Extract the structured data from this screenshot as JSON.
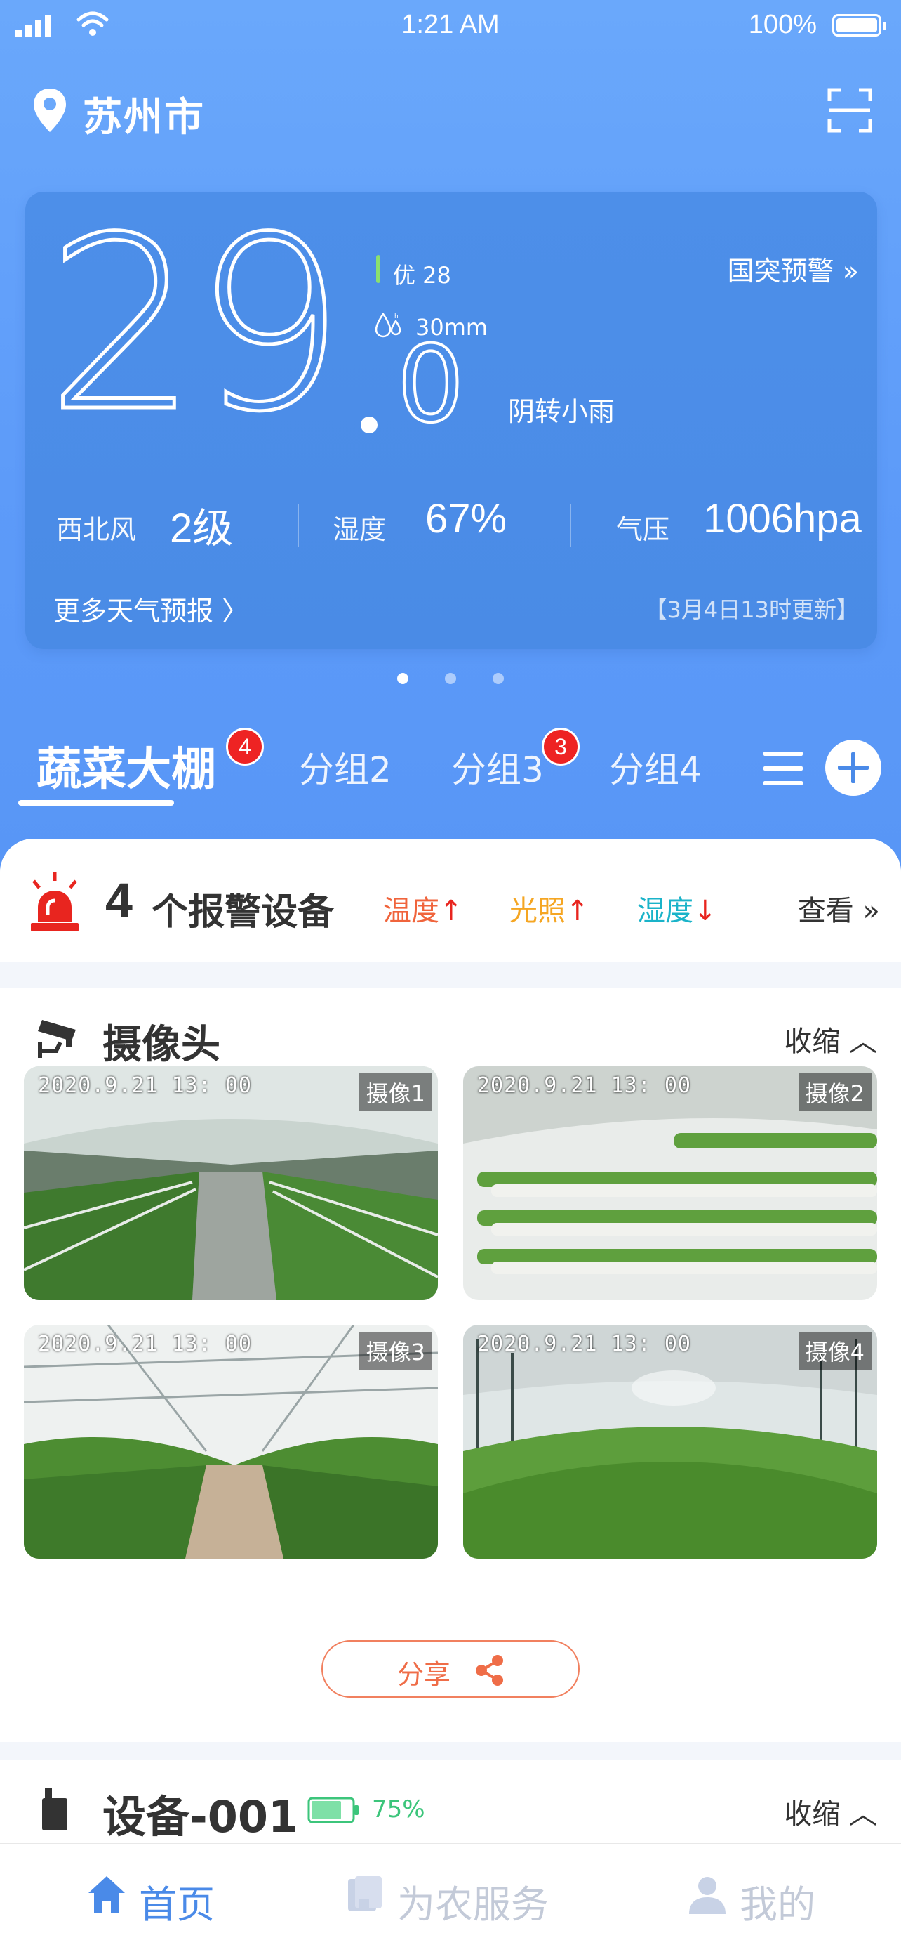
{
  "status_bar": {
    "time": "1:21 AM",
    "battery": "100%"
  },
  "header": {
    "city": "苏州市",
    "location_icon": "location-pin-icon",
    "scan_icon": "scan-icon"
  },
  "weather": {
    "temp_int": "29",
    "temp_dot": ".",
    "temp_dec": "0",
    "aqi": "优 28",
    "rainfall": "30mm",
    "condition": "阴转小雨",
    "alert_link": "国突预警 »",
    "wind_label": "西北风",
    "wind_value": "2级",
    "humidity_label": "湿度",
    "humidity_value": "67%",
    "pressure_label": "气压",
    "pressure_value": "1006hpa",
    "more_link": "更多天气预报 〉",
    "updated": "【3月4日13时更新】"
  },
  "pager": {
    "pages": 3,
    "active": 0
  },
  "tabs": [
    {
      "label": "蔬菜大棚",
      "badge": "4",
      "active": true
    },
    {
      "label": "分组2",
      "badge": "",
      "active": false
    },
    {
      "label": "分组3",
      "badge": "3",
      "active": false
    },
    {
      "label": "分组4",
      "badge": "",
      "active": false
    }
  ],
  "alarm": {
    "count": "4",
    "title": "个报警设备",
    "tags": [
      {
        "label": "温度",
        "arrow": "↑",
        "color": "#f0643c"
      },
      {
        "label": "光照",
        "arrow": "↑",
        "color": "#f5a623"
      },
      {
        "label": "湿度",
        "arrow": "↓",
        "color": "#1ab3c9"
      }
    ],
    "view": "查看 »"
  },
  "camera_section": {
    "title": "摄像头",
    "collapse": "收缩 ︿",
    "cameras": [
      {
        "time": "2020.9.21 13: 00",
        "label": "摄像1"
      },
      {
        "time": "2020.9.21 13: 00",
        "label": "摄像2"
      },
      {
        "time": "2020.9.21 13: 00",
        "label": "摄像3"
      },
      {
        "time": "2020.9.21 13: 00",
        "label": "摄像4"
      }
    ],
    "share": "分享"
  },
  "device_section": {
    "title": "设备-001",
    "battery": "75%",
    "collapse": "收缩 ︿"
  },
  "tab_bar": [
    {
      "label": "首页",
      "icon": "home-icon",
      "active": true
    },
    {
      "label": "为农服务",
      "icon": "book-icon",
      "active": false
    },
    {
      "label": "我的",
      "icon": "user-icon",
      "active": false
    }
  ],
  "colors": {
    "primary": "#4a8ae8",
    "alarm_red": "#e8251f",
    "share_orange": "#ef6d48",
    "battery_green": "#3cc57b"
  }
}
